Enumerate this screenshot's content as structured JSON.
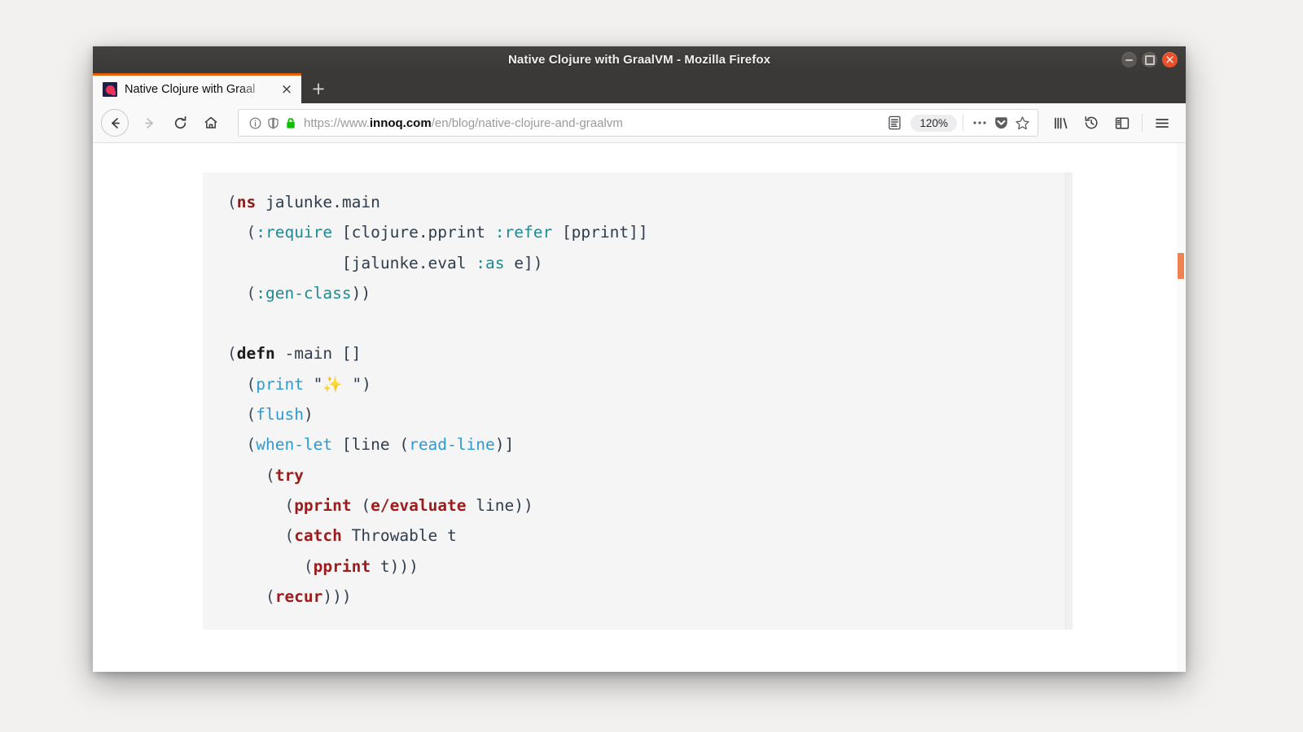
{
  "window": {
    "title": "Native Clojure with GraalVM - Mozilla Firefox",
    "controls": {
      "minimize_label": "Minimize",
      "maximize_label": "Maximize",
      "close_label": "Close"
    }
  },
  "tabs": {
    "items": [
      {
        "title": "Native Clojure with Graal",
        "favicon": "innoq-logo-icon",
        "close_label": "×",
        "active": true
      }
    ],
    "new_tab_label": "+"
  },
  "toolbar": {
    "back_icon": "back-arrow-icon",
    "forward_icon": "forward-arrow-icon",
    "reload_icon": "reload-icon",
    "home_icon": "home-icon",
    "library_icon": "library-icon",
    "history_icon": "history-icon",
    "sidebar_icon": "sidebar-icon",
    "menu_icon": "hamburger-menu-icon"
  },
  "urlbar": {
    "info_icon": "page-info-icon",
    "shield_icon": "tracking-protection-shield-icon",
    "lock_icon": "padlock-secure-icon",
    "lock_color": "#12bc00",
    "url_scheme": "https://www.",
    "url_host": "innoq.com",
    "url_path": "/en/blog/native-clojure-and-graalvm",
    "url_full": "https://www.innoq.com/en/blog/native-clojure-and-graalvm",
    "reader_icon": "reader-mode-icon",
    "zoom_level": "120%",
    "page_actions_icon": "ellipsis-icon",
    "pocket_icon": "pocket-icon",
    "bookmark_icon": "star-bookmark-icon"
  },
  "page": {
    "accent_color": "#ed8253",
    "code_background": "#f5f5f5",
    "code_block": {
      "language": "clojure",
      "lines": [
        [
          {
            "t": "(",
            "c": "paren"
          },
          {
            "t": "ns",
            "c": "ns"
          },
          {
            "t": " jalunke.main",
            "c": "plain"
          }
        ],
        [
          {
            "t": "  (",
            "c": "paren"
          },
          {
            "t": ":require",
            "c": "kw"
          },
          {
            "t": " [clojure.pprint ",
            "c": "plain"
          },
          {
            "t": ":refer",
            "c": "kw"
          },
          {
            "t": " [pprint]]",
            "c": "plain"
          }
        ],
        [
          {
            "t": "            [jalunke.eval ",
            "c": "plain"
          },
          {
            "t": ":as",
            "c": "kw"
          },
          {
            "t": " e])",
            "c": "plain"
          }
        ],
        [
          {
            "t": "  (",
            "c": "paren"
          },
          {
            "t": ":gen-class",
            "c": "kw"
          },
          {
            "t": "))",
            "c": "plain"
          }
        ],
        [],
        [
          {
            "t": "(",
            "c": "paren"
          },
          {
            "t": "defn",
            "c": "defn"
          },
          {
            "t": " -main []",
            "c": "plain"
          }
        ],
        [
          {
            "t": "  (",
            "c": "paren"
          },
          {
            "t": "print",
            "c": "fn"
          },
          {
            "t": " \"✨ \")",
            "c": "plain"
          }
        ],
        [
          {
            "t": "  (",
            "c": "paren"
          },
          {
            "t": "flush",
            "c": "fn"
          },
          {
            "t": ")",
            "c": "plain"
          }
        ],
        [
          {
            "t": "  (",
            "c": "paren"
          },
          {
            "t": "when-let",
            "c": "fn"
          },
          {
            "t": " [line (",
            "c": "plain"
          },
          {
            "t": "read-line",
            "c": "fn"
          },
          {
            "t": ")]",
            "c": "plain"
          }
        ],
        [
          {
            "t": "    (",
            "c": "paren"
          },
          {
            "t": "try",
            "c": "red"
          }
        ],
        [
          {
            "t": "      (",
            "c": "paren"
          },
          {
            "t": "pprint",
            "c": "red"
          },
          {
            "t": " (",
            "c": "plain"
          },
          {
            "t": "e/evaluate",
            "c": "red"
          },
          {
            "t": " line))",
            "c": "plain"
          }
        ],
        [
          {
            "t": "      (",
            "c": "paren"
          },
          {
            "t": "catch",
            "c": "red"
          },
          {
            "t": " Throwable t",
            "c": "plain"
          }
        ],
        [
          {
            "t": "        (",
            "c": "paren"
          },
          {
            "t": "pprint",
            "c": "red"
          },
          {
            "t": " t)))",
            "c": "plain"
          }
        ],
        [
          {
            "t": "    (",
            "c": "paren"
          },
          {
            "t": "recur",
            "c": "red"
          },
          {
            "t": ")))",
            "c": "plain"
          }
        ]
      ],
      "plain_text": "(ns jalunke.main\n  (:require [clojure.pprint :refer [pprint]]\n            [jalunke.eval :as e])\n  (:gen-class))\n\n(defn -main []\n  (print \"✨ \")\n  (flush)\n  (when-let [line (read-line)]\n    (try\n      (pprint (e/evaluate line))\n      (catch Throwable t\n        (pprint t)))\n    (recur)))"
    }
  }
}
